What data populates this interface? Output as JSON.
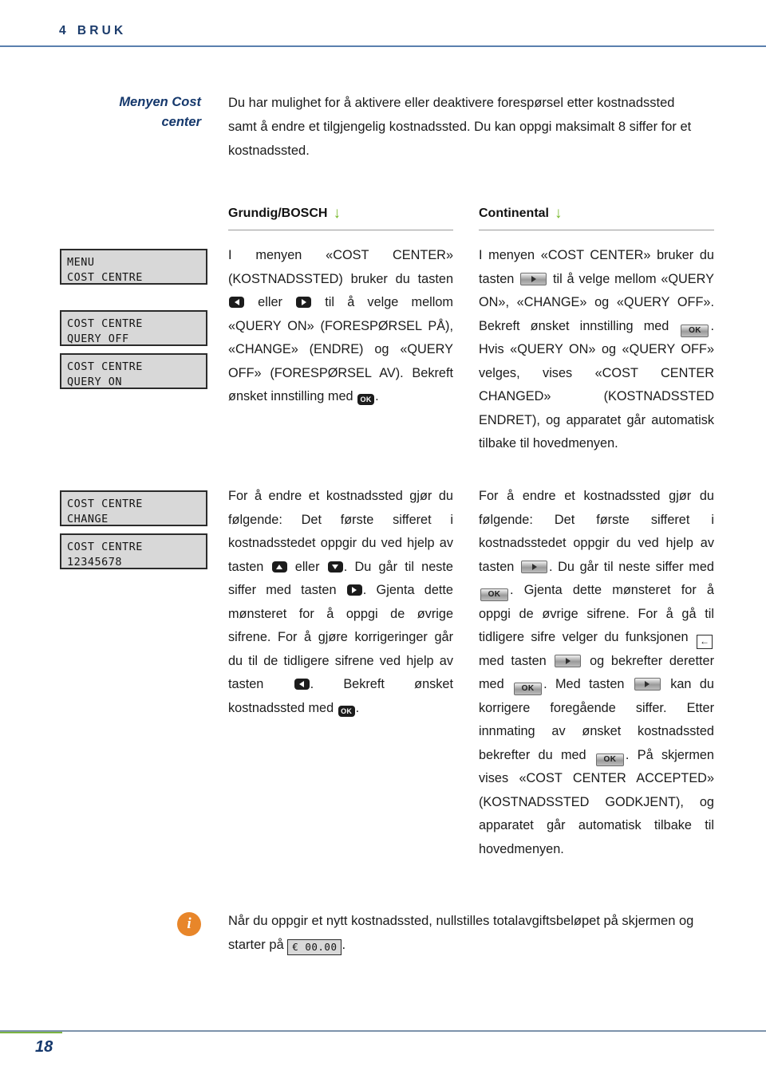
{
  "header": {
    "chapter_number": "4",
    "chapter_title": "BRUK",
    "rule_color": "#5a7fae"
  },
  "intro": {
    "sidenote_line1": "Menyen Cost",
    "sidenote_line2": "center",
    "sidenote_color": "#15386c",
    "body": "Du har mulighet for å aktivere eller deaktivere forespørsel etter kostnadssted samt å endre et tilgjengelig kostnadssted. Du kan oppgi maksimalt 8 siffer for et kostnadssted."
  },
  "columns": {
    "grundig": {
      "heading": "Grundig/BOSCH",
      "arrow_glyph": "↓",
      "arrow_color": "#76b82a"
    },
    "continental": {
      "heading": "Continental",
      "arrow_glyph": "↓",
      "arrow_color": "#76b82a"
    }
  },
  "displays": [
    {
      "name": "display-menu-cost-centre",
      "line1": "MENU",
      "line2": "COST CENTRE"
    },
    {
      "name": "display-query-off",
      "line1": "COST CENTRE",
      "line2": "QUERY OFF"
    },
    {
      "name": "display-query-on",
      "line1": "COST CENTRE",
      "line2": "QUERY ON"
    },
    {
      "name": "display-change",
      "line1": "COST CENTRE",
      "line2": "CHANGE"
    },
    {
      "name": "display-digits",
      "line1": "COST CENTRE",
      "line2": "12345678"
    }
  ],
  "grundig_para1": {
    "t1": "I menyen «COST CENTER» (KOSTNADSSTED) bruker du tasten ",
    "t2": " eller ",
    "t3": " til å velge mellom «QUERY ON» (FORESPØRSEL PÅ), «CHANGE» (ENDRE) og «QUERY OFF» (FORESPØRSEL AV). Bekreft ønsket innstilling med ",
    "t4": "."
  },
  "continental_para1": {
    "t1": "I menyen «COST CENTER» bruker du tasten ",
    "t2": " til å velge mellom «QUERY ON», «CHANGE» og «QUERY OFF». Bekreft ønsket innstilling med ",
    "t3": ". Hvis «QUERY ON» og «QUERY OFF» velges, vises «COST CENTER CHANGED» (KOSTNADSSTED ENDRET), og apparatet går automatisk tilbake til hovedmenyen."
  },
  "grundig_para2": {
    "t1": "For å endre et kostnadssted gjør du følgende: Det første sifferet i kostnadsstedet oppgir du ved hjelp av tasten ",
    "t2": " eller ",
    "t3": ". Du går til neste siffer med tasten ",
    "t4": ". Gjenta dette mønsteret for å oppgi de øvrige sifrene. For å gjøre korrigeringer går du til de tidligere sifrene ved hjelp av tasten ",
    "t5": ". Bekreft ønsket kostnadssted med ",
    "t6": "."
  },
  "continental_para2": {
    "t1": "For å endre et kostnadssted gjør du følgende: Det første sifferet i kostnadsstedet oppgir du ved hjelp av tasten ",
    "t2": ". Du går til neste siffer med ",
    "t3": ". Gjenta dette mønsteret for å oppgi de øvrige sifrene. For å gå til tidligere sifre velger du funksjonen ",
    "t4": " med tasten ",
    "t5": " og bekrefter deretter med ",
    "t6": ". Med tasten ",
    "t7": " kan du korrigere foregående siffer. Etter innmating av ønsket kostnadssted bekrefter du med ",
    "t8": ". På skjermen vises «COST CENTER ACCEPTED» (KOSTNADSSTED GODKJENT), og apparatet går automatisk tilbake til hovedmenyen."
  },
  "keys": {
    "ok_label": "OK",
    "back_glyph": "←"
  },
  "note": {
    "icon_glyph": "i",
    "icon_color": "#e8862a",
    "t1": "Når du oppgir et nytt kostnadssted, nullstilles totalavgiftsbeløpet på skjermen og starter på ",
    "amount": "€ 00.00",
    "t2": "."
  },
  "footer": {
    "page_number": "18",
    "rule_color": "#7d93ab",
    "accent_color": "#7cb342"
  }
}
